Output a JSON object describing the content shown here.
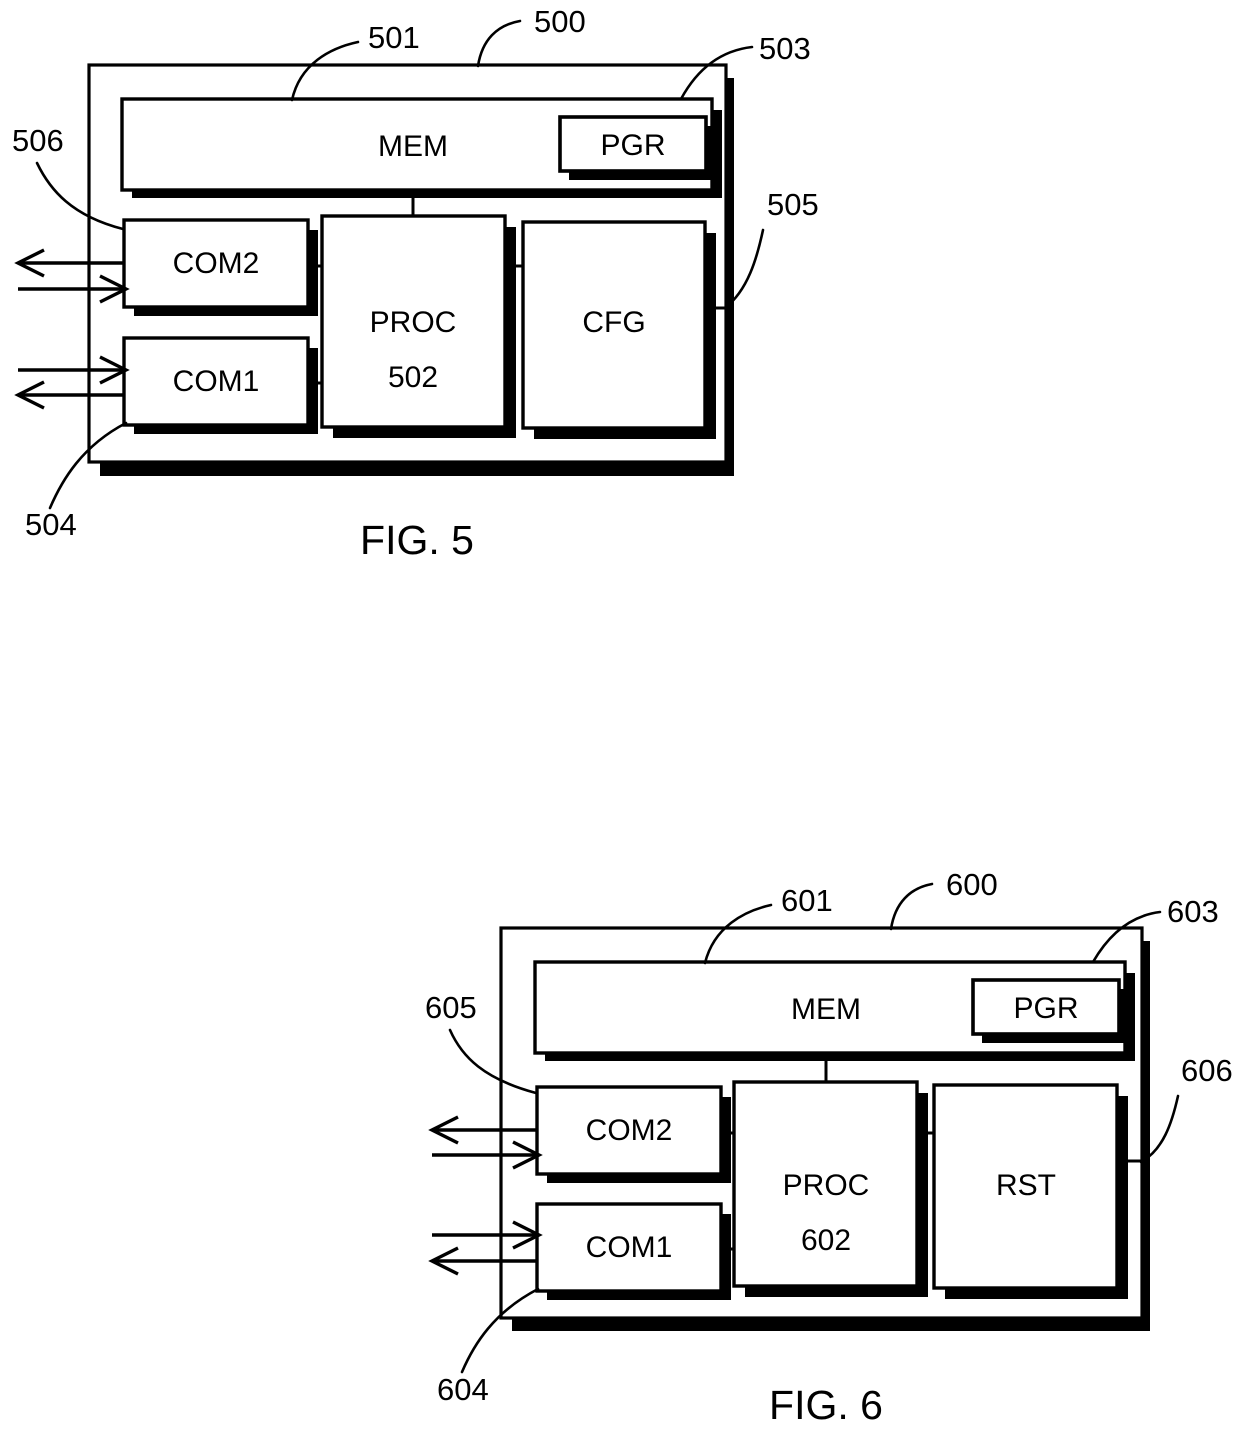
{
  "document": {
    "type": "patent-drawing-sheet",
    "figures": [
      {
        "id": "fig5",
        "caption": "FIG. 5",
        "outer_ref": "500",
        "blocks": [
          {
            "name": "mem",
            "label": "MEM",
            "ref": "501"
          },
          {
            "name": "pgr",
            "label": "PGR",
            "ref": "503"
          },
          {
            "name": "com2",
            "label": "COM2",
            "ref": "506"
          },
          {
            "name": "com1",
            "label": "COM1",
            "ref": "504"
          },
          {
            "name": "proc",
            "label": "PROC",
            "sublabel": "502",
            "ref": "502"
          },
          {
            "name": "cfg",
            "label": "CFG",
            "ref": "505"
          }
        ],
        "reference_numerals": [
          "500",
          "501",
          "502",
          "503",
          "504",
          "505",
          "506"
        ],
        "signal_arrows": [
          {
            "block": "COM2",
            "direction": "out"
          },
          {
            "block": "COM2",
            "direction": "in"
          },
          {
            "block": "COM1",
            "direction": "in"
          },
          {
            "block": "COM1",
            "direction": "out"
          }
        ]
      },
      {
        "id": "fig6",
        "caption": "FIG. 6",
        "outer_ref": "600",
        "blocks": [
          {
            "name": "mem",
            "label": "MEM",
            "ref": "601"
          },
          {
            "name": "pgr",
            "label": "PGR",
            "ref": "603"
          },
          {
            "name": "com2",
            "label": "COM2",
            "ref": "605"
          },
          {
            "name": "com1",
            "label": "COM1",
            "ref": "604"
          },
          {
            "name": "proc",
            "label": "PROC",
            "sublabel": "602",
            "ref": "602"
          },
          {
            "name": "rst",
            "label": "RST",
            "ref": "606"
          }
        ],
        "reference_numerals": [
          "600",
          "601",
          "602",
          "603",
          "604",
          "605",
          "606"
        ],
        "signal_arrows": [
          {
            "block": "COM2",
            "direction": "out"
          },
          {
            "block": "COM2",
            "direction": "in"
          },
          {
            "block": "COM1",
            "direction": "in"
          },
          {
            "block": "COM1",
            "direction": "out"
          }
        ]
      }
    ]
  },
  "fig5": {
    "caption": "FIG. 5",
    "labels": {
      "mem": "MEM",
      "pgr": "PGR",
      "com2": "COM2",
      "com1": "COM1",
      "proc": "PROC",
      "proc_num": "502",
      "cfg": "CFG"
    },
    "refs": {
      "r500": "500",
      "r501": "501",
      "r503": "503",
      "r504": "504",
      "r505": "505",
      "r506": "506"
    }
  },
  "fig6": {
    "caption": "FIG. 6",
    "labels": {
      "mem": "MEM",
      "pgr": "PGR",
      "com2": "COM2",
      "com1": "COM1",
      "proc": "PROC",
      "proc_num": "602",
      "rst": "RST"
    },
    "refs": {
      "r600": "600",
      "r601": "601",
      "r603": "603",
      "r604": "604",
      "r605": "605",
      "r606": "606"
    }
  },
  "colors": {
    "ink": "#000000",
    "paper": "#ffffff"
  }
}
